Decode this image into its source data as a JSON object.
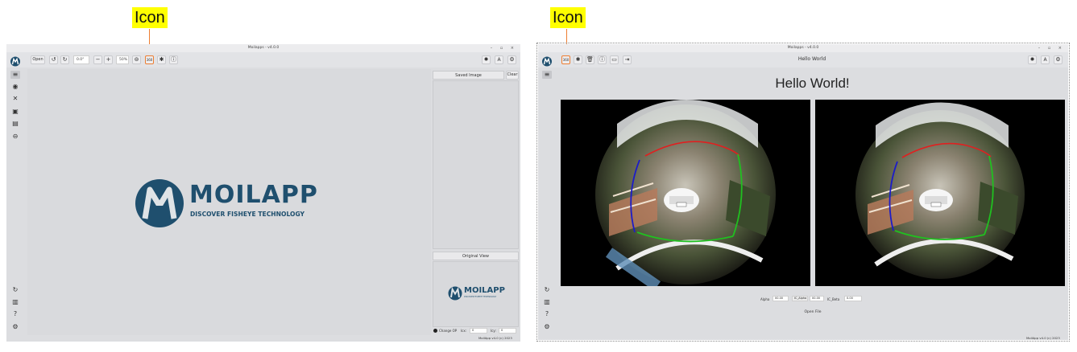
{
  "callouts": {
    "left_label": "Icon",
    "right_label": "Icon"
  },
  "left_window": {
    "title": "Moilapps - v4.0.0",
    "controls": "– ▫ ×",
    "toolbar": {
      "open_label": "Open",
      "rotate_value": "0.0°",
      "zoom_value": "50%"
    },
    "logo": {
      "brand": "MOILAPP",
      "tagline": "DISCOVER FISHEYE TECHNOLOGY"
    },
    "saved_image": {
      "header": "Saved Image",
      "clear_label": "Clear"
    },
    "original_view": {
      "header": "Original View",
      "mini_brand": "MOILAPP",
      "mini_tagline": "DISCOVER FISHEYE TECHNOLOGY",
      "change_op_label": "Change OP",
      "icx_label": "Icx:",
      "icx_value": "0",
      "icy_label": "Icy:",
      "icy_value": "0"
    },
    "footer": "MoilApp v4.0 (c) 2023"
  },
  "right_window": {
    "title": "Moilapps - v4.0.0",
    "controls": "– ▫ ×",
    "toolbar_title": "Hello World",
    "heading": "Hello World!",
    "params": {
      "alpha_label": "Alpha",
      "alpha_value": "00.00",
      "ic_alpha_label": "IC_Alpha",
      "ic_alpha_value": "00.00",
      "ic_beta_label": "IC_Beta",
      "ic_beta_value": "0.00"
    },
    "open_file_label": "Open File",
    "footer": "MoilApp v4.0 (c) 2023"
  },
  "colors": {
    "highlight": "#ed7d31",
    "callout_bg": "#ffff00",
    "brand": "#1f4f6e"
  }
}
